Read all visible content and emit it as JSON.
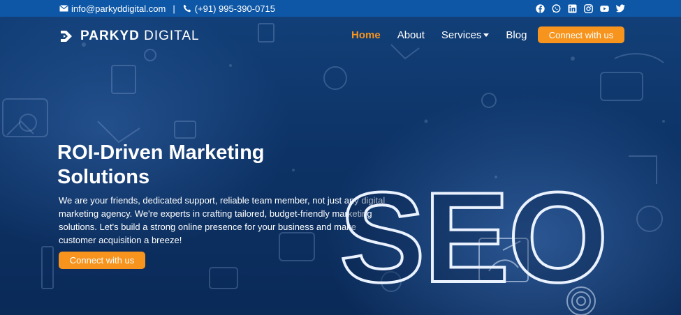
{
  "topbar": {
    "email": "info@parkyddigital.com",
    "separator": "|",
    "phone": "(+91) 995-390-0715",
    "socials": [
      "facebook-icon",
      "whatsapp-icon",
      "linkedin-icon",
      "instagram-icon",
      "youtube-icon",
      "twitter-icon"
    ]
  },
  "brand": {
    "name_bold": "PARKYD",
    "name_light": "DIGITAL"
  },
  "nav": {
    "home": "Home",
    "about": "About",
    "services": "Services",
    "blog": "Blog",
    "cta": "Connect with us"
  },
  "hero": {
    "headline_line1": "ROI-Driven Marketing",
    "headline_line2": "Solutions",
    "description": "We are your friends, dedicated support, reliable team member, not just any digital marketing agency. We're experts in crafting tailored, budget-friendly marketing solutions. Let's build a strong online presence for your business and make customer acquisition a breeze!",
    "cta": "Connect with us",
    "graphic_text": "SEO"
  },
  "colors": {
    "topbar": "#0d57a6",
    "accent": "#f7941d",
    "hero_bg": "#0d3366"
  }
}
